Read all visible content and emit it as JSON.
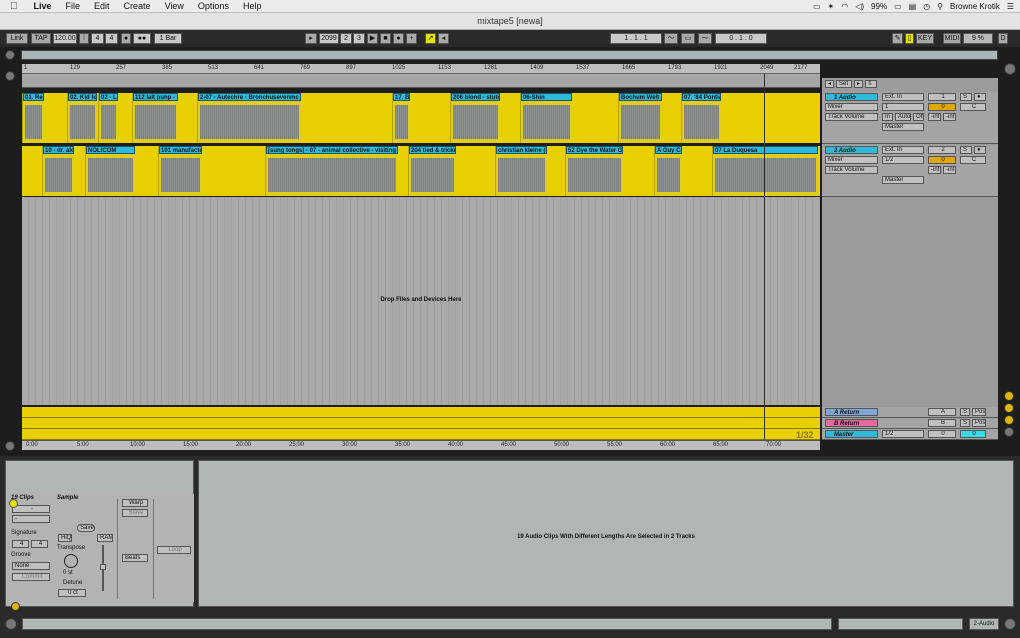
{
  "menubar": {
    "apple": "",
    "app": "Live",
    "items": [
      "File",
      "Edit",
      "Create",
      "View",
      "Options",
      "Help"
    ],
    "battery": "99%",
    "user": "Browne Krotik"
  },
  "window": {
    "title": "mixtape5  [newa]"
  },
  "control": {
    "link": "Link",
    "tap": "TAP",
    "tempo": "120.00",
    "sig_num": "4",
    "sig_den": "4",
    "quant": "1 Bar",
    "pos_bar": "2099",
    "pos_beat": "2",
    "pos_sixteenth": "3",
    "loop_start": "1  .  1  .  1",
    "loop_len": "0  .  1  .  0",
    "key": "KEY",
    "midi": "MIDI",
    "cpu": "9 %",
    "d": "D"
  },
  "ruler": {
    "marks": [
      "1",
      "129",
      "257",
      "385",
      "513",
      "641",
      "769",
      "897",
      "1025",
      "1153",
      "1281",
      "1409",
      "1537",
      "1665",
      "1793",
      "1921",
      "2049",
      "2177"
    ]
  },
  "timeruler": {
    "marks": [
      "0:00",
      "5:00",
      "10:00",
      "15:00",
      "20:00",
      "25:00",
      "30:00",
      "35:00",
      "40:00",
      "45:00",
      "50:00",
      "55:00",
      "60:00",
      "65:00",
      "70:00"
    ]
  },
  "fraction": "1/32",
  "track1": {
    "clips": [
      "01. Re",
      "02. Kid for",
      "02 - Le",
      "112 lalt punp - ",
      "2-07 - Autechre - Bronchusevenmc",
      "17. Be",
      "206 blond - stuto",
      "06-Shin",
      "Bochum Welt - ",
      "07. '84 Pontia"
    ]
  },
  "track2": {
    "clips": [
      "10 - dr. alo",
      "NOLICOM",
      "101 manufactur",
      "[sung tongs] - 07 - animal collective - visiting fr",
      "204 tied & tricke",
      "christian kleine (E",
      "52 Dye the Water Gr",
      "A Guy Ca",
      "07 La Duquesa"
    ]
  },
  "drop_text": "Drop Files and Devices Here",
  "mixer": {
    "set": "Set",
    "t1": {
      "name": "1 Audio",
      "input": "Ext. In",
      "input_ch": "1",
      "device": "Mixer",
      "param": "Track Volume",
      "monitor_in": "In",
      "monitor_auto": "Auto",
      "monitor_off": "Off",
      "out": "Master",
      "num": "1",
      "vol": "-inf",
      "pan": "-inf",
      "s": "S",
      "c": "C",
      "zero": "0"
    },
    "t2": {
      "name": "2 Audio",
      "input": "Ext. In",
      "input_ch": "1/2",
      "device": "Mixer",
      "param": "Track Volume",
      "out": "Master",
      "num": "2",
      "vol": "-inf",
      "pan": "-inf",
      "s": "S",
      "c": "C",
      "zero": "0"
    },
    "ra": {
      "name": "A Return",
      "letter": "A",
      "s": "S",
      "post": "Post"
    },
    "rb": {
      "name": "B Return",
      "letter": "B",
      "s": "S",
      "post": "Post"
    },
    "master": {
      "name": "Master",
      "ch": "1/2",
      "num": "0",
      "zero": "0"
    }
  },
  "clipview": {
    "count": "19 Clips",
    "signature": "Signature",
    "sig_num": "4",
    "sig_den": "4",
    "groove": "Groove",
    "groove_val": "None",
    "commit": "Commit",
    "dash": "-"
  },
  "sample": {
    "title": "Sample",
    "save": "Save",
    "hiq": "HiQ",
    "ram": "RAM",
    "transpose": "Transpose",
    "transpose_val": "0 st",
    "detune": "Detune",
    "detune_val": "0 ct",
    "warp": "Warp",
    "slave": "Slave",
    "beats": "Beats",
    "loop": "Loop"
  },
  "info_text": "19 Audio Clips With Different Lengths Are Selected in 2 Tracks",
  "status": {
    "track": "2-Audio"
  }
}
